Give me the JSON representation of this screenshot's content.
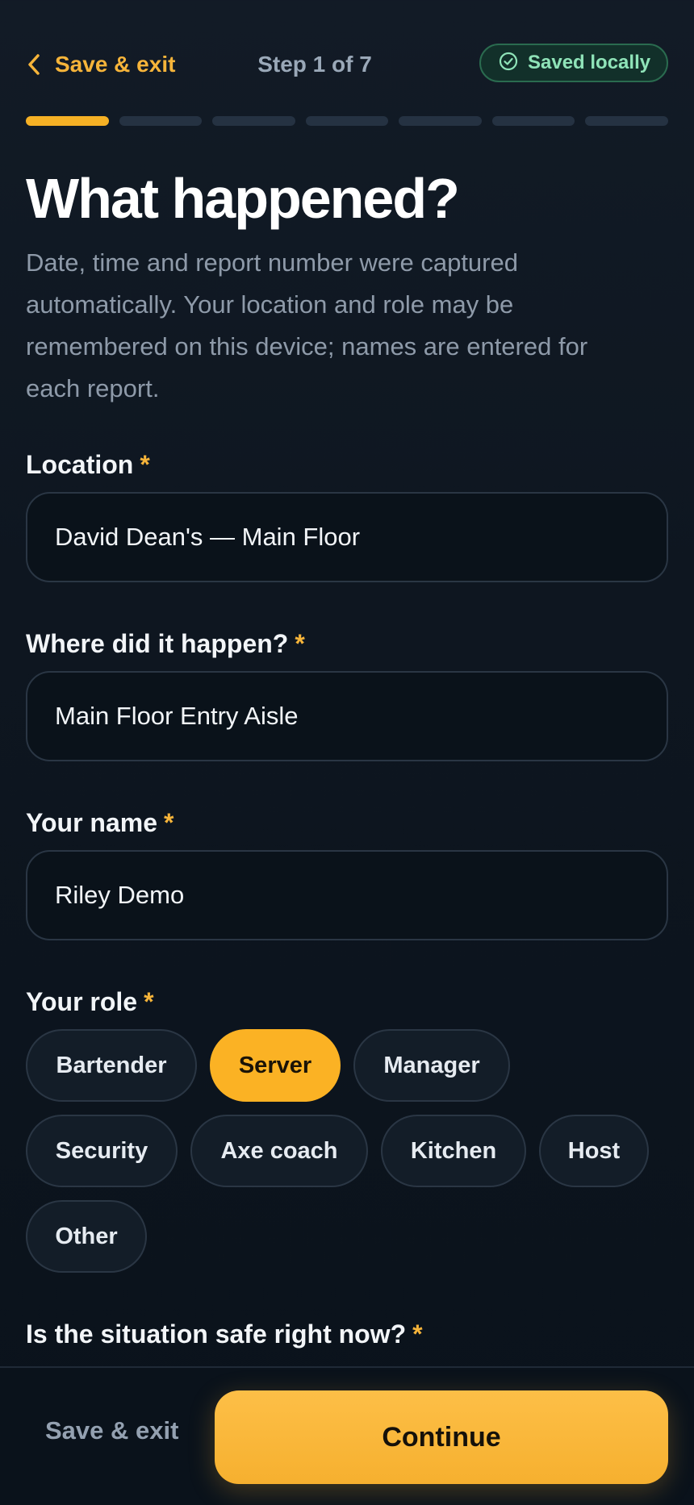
{
  "header": {
    "back_label": "Save & exit",
    "step_text": "Step 1 of 7",
    "saved_status": "Saved locally",
    "total_steps": 7,
    "current_step": 1
  },
  "main": {
    "title": "What happened?",
    "intro": "Date, time and report number were captured automatically. Your location and role may be remembered on this device; names are entered for each report.",
    "required_marker": "*",
    "fields": {
      "location": {
        "label": "Location",
        "value": "David Dean's — Main Floor"
      },
      "where": {
        "label": "Where did it happen?",
        "value": "Main Floor Entry Aisle"
      },
      "name": {
        "label": "Your name",
        "value": "Riley Demo"
      }
    },
    "role": {
      "label": "Your role",
      "options": [
        "Bartender",
        "Server",
        "Manager",
        "Security",
        "Axe coach",
        "Kitchen",
        "Host",
        "Other"
      ],
      "selected": "Server"
    },
    "safety_question": "Is the situation safe right now?"
  },
  "footer": {
    "save_label": "Save & exit",
    "continue_label": "Continue"
  },
  "colors": {
    "accent": "#f6b125",
    "saved_green": "#8fe3b8",
    "background": "#0e1620"
  },
  "icons": {
    "back": "chevron-left-icon",
    "saved": "check-circle-icon"
  }
}
